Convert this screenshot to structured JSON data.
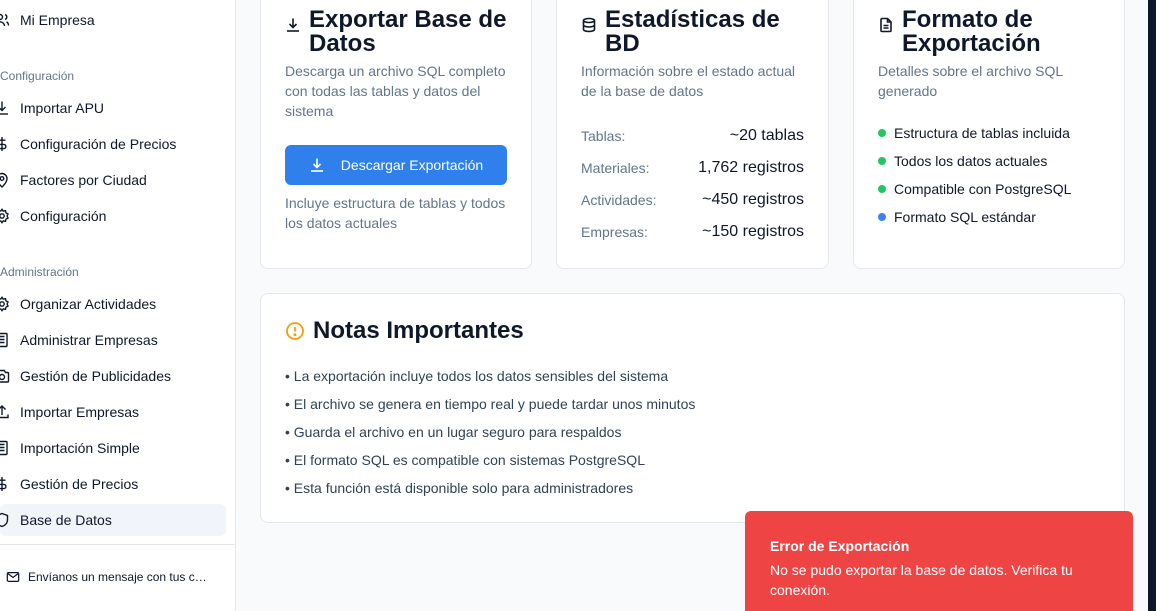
{
  "sidebar": {
    "top_item": "Mi Empresa",
    "sections": [
      {
        "title": "Configuración"
      },
      {
        "title": "Administración"
      }
    ],
    "items": [
      {
        "label": "Importar APU",
        "icon": "import-icon"
      },
      {
        "label": "Configuración de Precios",
        "icon": "dollar-icon"
      },
      {
        "label": "Factores por Ciudad",
        "icon": "map-pin-icon"
      },
      {
        "label": "Configuración",
        "icon": "gear-icon"
      },
      {
        "label": "Organizar Actividades",
        "icon": "gear-icon"
      },
      {
        "label": "Administrar Empresas",
        "icon": "building-icon"
      },
      {
        "label": "Gestión de Publicidades",
        "icon": "camera-icon"
      },
      {
        "label": "Importar Empresas",
        "icon": "upload-icon"
      },
      {
        "label": "Importación Simple",
        "icon": "building-icon"
      },
      {
        "label": "Gestión de Precios",
        "icon": "dollar-icon"
      },
      {
        "label": "Base de Datos",
        "icon": "shield-icon"
      }
    ],
    "active_item": "Base de Datos",
    "contact": "Envíanos un mensaje con tus c…"
  },
  "export_card": {
    "title": "Exportar Base de Datos",
    "description": "Descarga un archivo SQL completo con todas las tablas y datos del sistema",
    "button": "Descargar Exportación",
    "note": "Incluye estructura de tablas y todos los datos actuales"
  },
  "stats_card": {
    "title": "Estadísticas de BD",
    "description": "Información sobre el estado actual de la base de datos",
    "rows": [
      {
        "label": "Tablas:",
        "value": "~20 tablas"
      },
      {
        "label": "Materiales:",
        "value": "1,762 registros"
      },
      {
        "label": "Actividades:",
        "value": "~450 registros"
      },
      {
        "label": "Empresas:",
        "value": "~150 registros"
      }
    ]
  },
  "format_card": {
    "title": "Formato de Exportación",
    "description": "Detalles sobre el archivo SQL generado",
    "features": [
      {
        "label": "Estructura de tablas incluida",
        "color": "#22c55e"
      },
      {
        "label": "Todos los datos actuales",
        "color": "#22c55e"
      },
      {
        "label": "Compatible con PostgreSQL",
        "color": "#22c55e"
      },
      {
        "label": "Formato SQL estándar",
        "color": "#3b82f6"
      }
    ]
  },
  "notes_card": {
    "title": "Notas Importantes",
    "notes": [
      "• La exportación incluye todos los datos sensibles del sistema",
      "• El archivo se genera en tiempo real y puede tardar unos minutos",
      "• Guarda el archivo en un lugar seguro para respaldos",
      "• El formato SQL es compatible con sistemas PostgreSQL",
      "• Esta función está disponible solo para administradores"
    ]
  },
  "toast": {
    "title": "Error de Exportación",
    "description": "No se pudo exportar la base de datos. Verifica tu conexión."
  },
  "colors": {
    "primary": "#2f80ed",
    "error": "#ef4444",
    "warning": "#f59e0b",
    "success": "#22c55e",
    "info": "#3b82f6"
  }
}
